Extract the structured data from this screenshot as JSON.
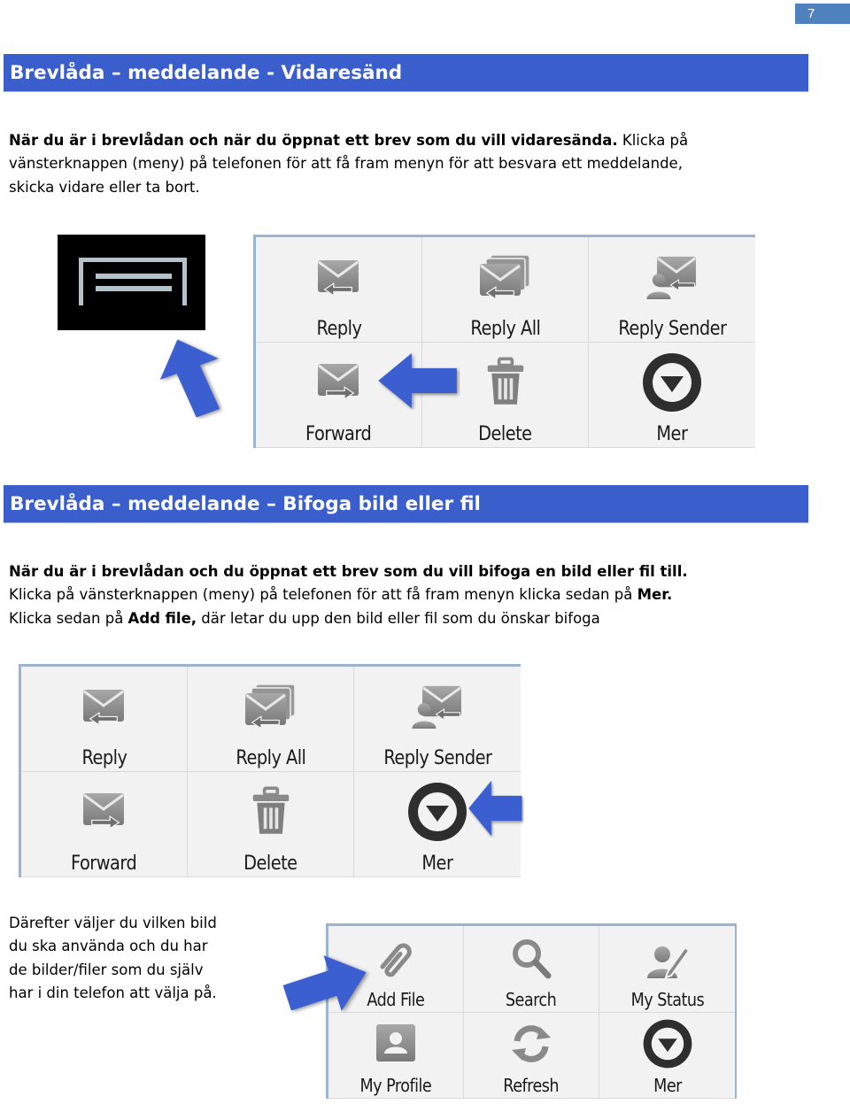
{
  "page": {
    "number": "7"
  },
  "colors": {
    "section_bar": "#3a5fcd",
    "page_badge": "#4f81bd",
    "arrow": "#3b5fd0",
    "icon_gray": "#8c8c8c"
  },
  "section1": {
    "title": "Brevlåda – meddelande - Vidaresänd",
    "intro_bold": "När du är i brevlådan och när du öppnat ett brev som du vill vidaresända.",
    "intro_rest_1": " Klicka på",
    "intro_line2": "vänsterknappen (meny) på telefonen för att få fram menyn för att besvara ett meddelande,",
    "intro_line3": "skicka vidare eller ta bort.",
    "menu_key_icon": "menu-key-icon",
    "menu": [
      {
        "label": "Reply",
        "icon": "reply-mail-icon"
      },
      {
        "label": "Reply All",
        "icon": "reply-all-mail-icon"
      },
      {
        "label": "Reply Sender",
        "icon": "reply-sender-icon"
      },
      {
        "label": "Forward",
        "icon": "forward-mail-icon"
      },
      {
        "label": "Delete",
        "icon": "trash-icon"
      },
      {
        "label": "Mer",
        "icon": "more-dropdown-icon"
      }
    ]
  },
  "section2": {
    "title": "Brevlåda – meddelande – Bifoga bild eller fil",
    "line1_bold": "När du är i brevlådan och du öppnat ett brev som du vill bifoga en bild eller fil till.",
    "line2_pre": "Klicka på vänsterknappen (meny) på telefonen för att få fram menyn klicka sedan på ",
    "line2_bold": "Mer.",
    "line3_pre": "Klicka sedan på ",
    "line3_bold": "Add file,",
    "line3_post": " där letar du upp den bild eller fil som du önskar bifoga",
    "menu": [
      {
        "label": "Reply",
        "icon": "reply-mail-icon"
      },
      {
        "label": "Reply All",
        "icon": "reply-all-mail-icon"
      },
      {
        "label": "Reply Sender",
        "icon": "reply-sender-icon"
      },
      {
        "label": "Forward",
        "icon": "forward-mail-icon"
      },
      {
        "label": "Delete",
        "icon": "trash-icon"
      },
      {
        "label": "Mer",
        "icon": "more-dropdown-icon"
      }
    ],
    "side_text": [
      "Därefter väljer du vilken bild",
      "du ska använda och du har",
      "de bilder/filer som du själv",
      "har i din telefon att välja på."
    ],
    "more_menu": [
      {
        "label": "Add File",
        "icon": "paperclip-icon"
      },
      {
        "label": "Search",
        "icon": "search-icon"
      },
      {
        "label": "My Status",
        "icon": "my-status-icon"
      },
      {
        "label": "My Profile",
        "icon": "profile-icon"
      },
      {
        "label": "Refresh",
        "icon": "refresh-icon"
      },
      {
        "label": "Mer",
        "icon": "more-dropdown-icon"
      }
    ]
  }
}
